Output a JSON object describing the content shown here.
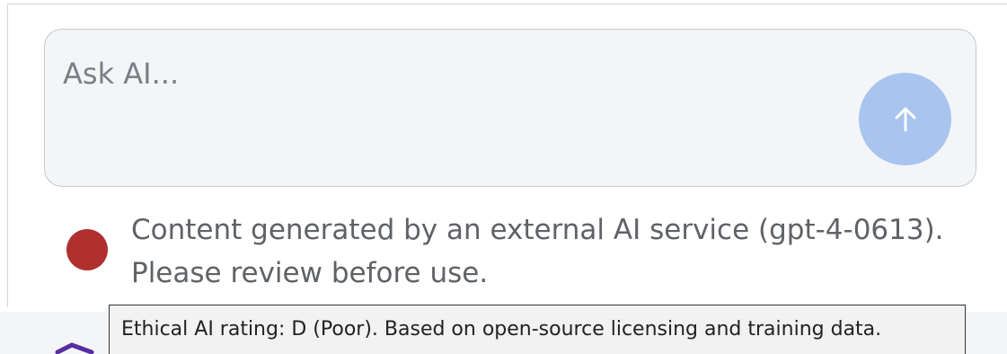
{
  "ask": {
    "placeholder": "Ask AI...",
    "value": ""
  },
  "send_button": {
    "icon": "arrow-up-icon",
    "color": "#a9c4ee"
  },
  "notice": {
    "text": "Content generated by an external AI service (gpt-4-0613). Please review before use.",
    "status_color": "#b03030"
  },
  "tooltip": {
    "text": "Ethical AI rating: D (Poor). Based on open-source licensing and training data."
  }
}
